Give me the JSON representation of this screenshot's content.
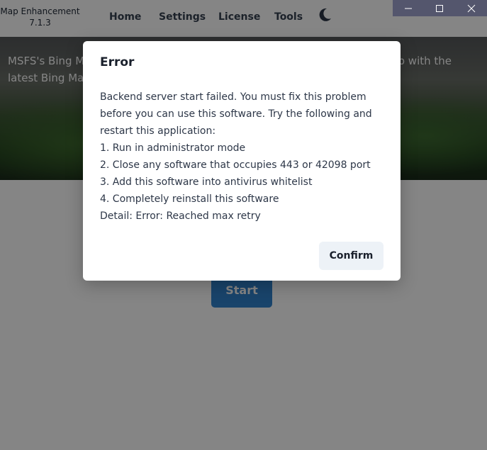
{
  "app": {
    "name": "Map Enhancement",
    "version": "7.1.3"
  },
  "nav": {
    "items": [
      "Home",
      "Settings",
      "License",
      "Tools"
    ],
    "theme_icon": "moon-icon"
  },
  "window_controls": {
    "icons": [
      "minimize-icon",
      "maximize-icon",
      "close-icon"
    ]
  },
  "banner": {
    "text": "MSFS's Bing Map is outdated. Map Enhancement will replace the Bing Map with the latest Bing Map"
  },
  "main": {
    "start_label": "Start"
  },
  "modal": {
    "title": "Error",
    "lines": [
      "Backend server start failed. You must fix this problem",
      "before you can use this software. Try the following and",
      "restart this application:",
      "1. Run in administrator mode",
      "2. Close any software that occupies 443 or 42098 port",
      "3. Add this software into antivirus whitelist",
      "4. Completely reinstall this software",
      "Detail: Error: Reached max retry"
    ],
    "confirm_label": "Confirm"
  },
  "colors": {
    "primary": "#3182ce",
    "overlay": "rgba(0,0,0,0.48)",
    "window_controls": "#2b2e4a"
  }
}
